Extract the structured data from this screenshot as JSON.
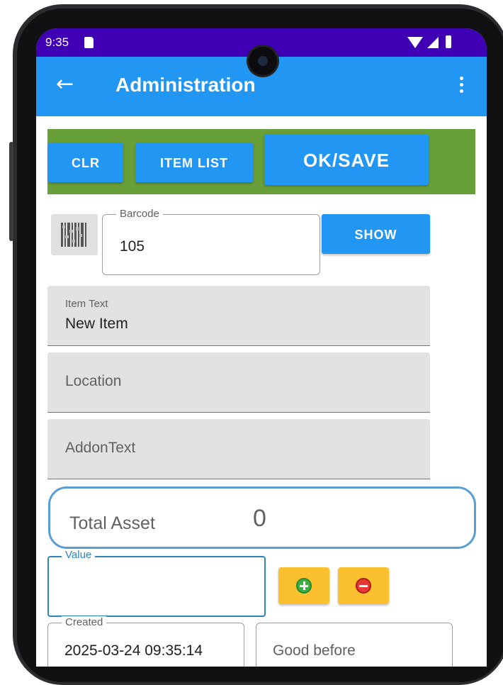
{
  "status_bar": {
    "time": "9:35"
  },
  "app_bar": {
    "title": "Administration",
    "back_icon": "arrow-left-icon",
    "menu_icon": "more-vert-icon"
  },
  "toolbar": {
    "clr_label": "CLR",
    "item_list_label": "ITEM LIST",
    "ok_save_label": "OK/SAVE",
    "background": "#689f38"
  },
  "barcode": {
    "label": "Barcode",
    "value": "105",
    "show_label": "SHOW",
    "scan_icon": "barcode-icon"
  },
  "item_text": {
    "label": "Item Text",
    "value": "New Item"
  },
  "location": {
    "placeholder": "Location"
  },
  "addon_text": {
    "placeholder": "AddonText"
  },
  "total_asset": {
    "label": "Total Asset",
    "value": "0"
  },
  "value_field": {
    "label": "Value",
    "value": ""
  },
  "quantity_buttons": {
    "increment_icon": "plus-circle-icon",
    "decrement_icon": "minus-circle-icon",
    "color": "#fbc02d"
  },
  "created": {
    "label": "Created",
    "value": "2025-03-24 09:35:14"
  },
  "good_before": {
    "placeholder": "Good before"
  },
  "colors": {
    "status_bar": "#3f00b5",
    "app_bar": "#2196f3",
    "button": "#2196f3"
  }
}
